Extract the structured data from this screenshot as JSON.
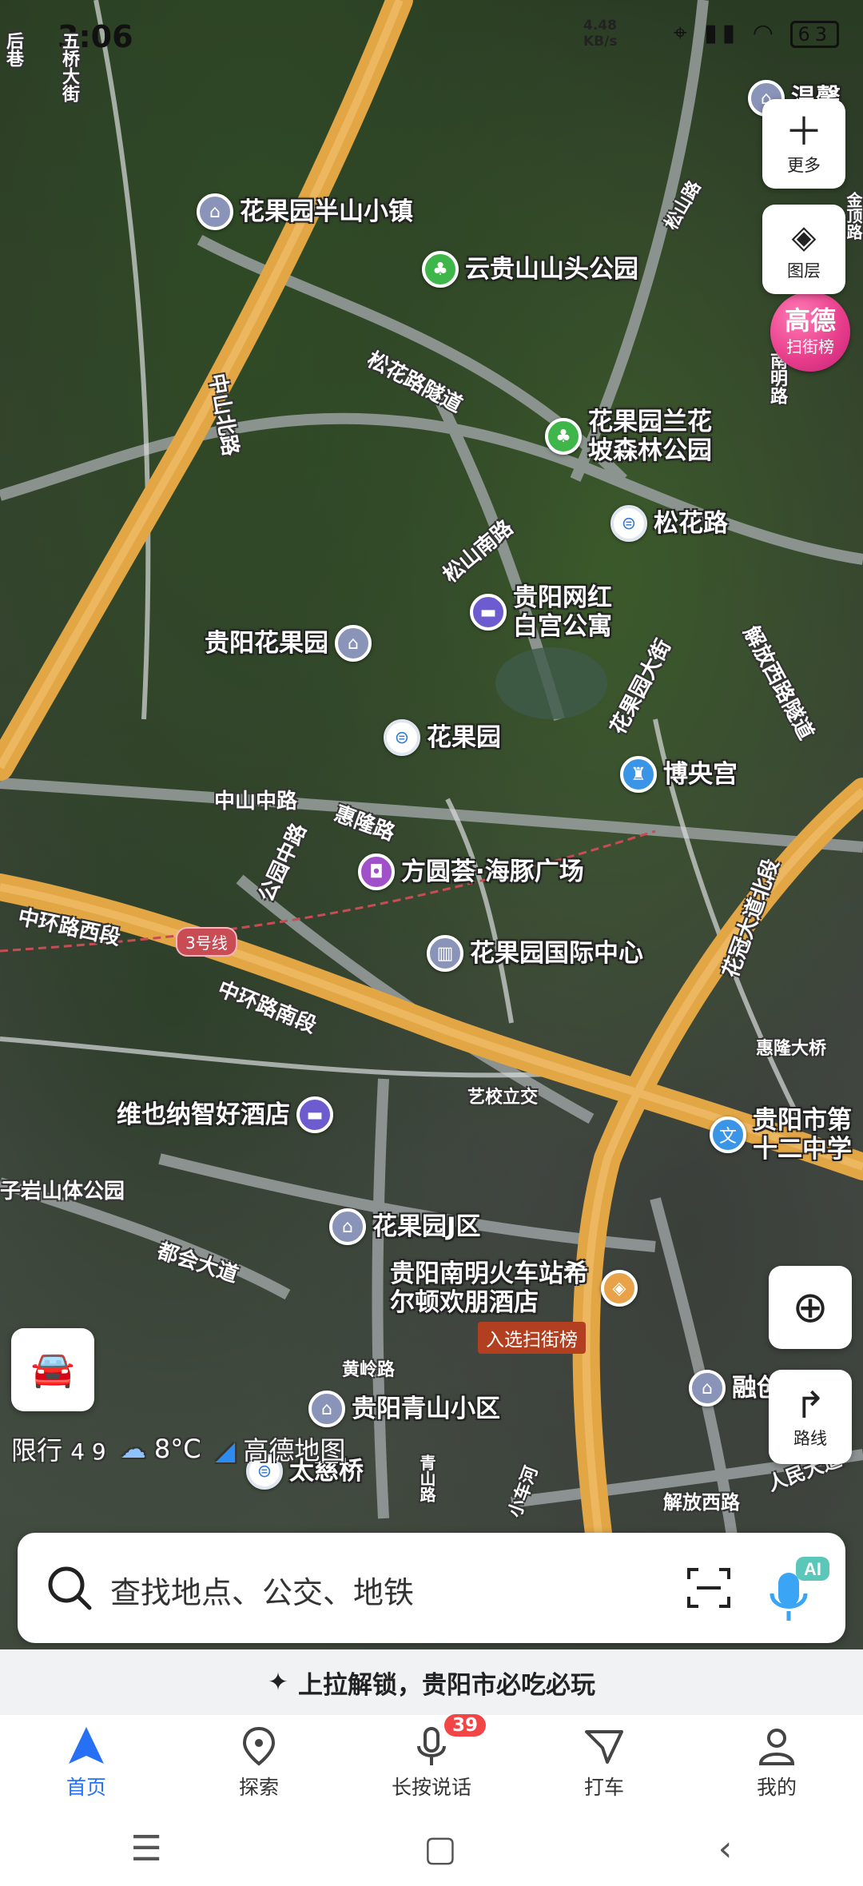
{
  "status_bar": {
    "time": "3:06",
    "net_speed": "4.48",
    "net_unit": "KB/s",
    "battery": "63"
  },
  "map": {
    "pois": [
      {
        "name": "花果园半山小镇",
        "type": "residential",
        "color": "#8a93b8"
      },
      {
        "name": "云贵山山头公园",
        "type": "park",
        "color": "#3fb64a"
      },
      {
        "name": "花果园兰花坡森林公园",
        "type": "park",
        "color": "#3fb64a"
      },
      {
        "name": "松花路",
        "type": "metro",
        "color": "#ffffff"
      },
      {
        "name": "贵阳网红白宫公寓",
        "type": "hotel",
        "color": "#6d5bd0"
      },
      {
        "name": "贵阳花果园",
        "type": "residential",
        "color": "#8a93b8"
      },
      {
        "name": "花果园",
        "type": "metro",
        "color": "#ffffff"
      },
      {
        "name": "博央宫",
        "type": "entertainment",
        "color": "#3a95e6"
      },
      {
        "name": "方圆荟·海豚广场",
        "type": "shopping",
        "color": "#a051c9"
      },
      {
        "name": "花果园国际中心",
        "type": "building",
        "color": "#8a93b8"
      },
      {
        "name": "维也纳智好酒店",
        "type": "hotel",
        "color": "#6d5bd0"
      },
      {
        "name": "贵阳市第十二中学",
        "type": "school",
        "color": "#3a95e6"
      },
      {
        "name": "花果园J区",
        "type": "residential",
        "color": "#8a93b8"
      },
      {
        "name": "贵阳南明火车站希尔顿欢朋酒店",
        "type": "hotel",
        "color": "#e8a24a"
      },
      {
        "name": "贵阳青山小区",
        "type": "residential",
        "color": "#8a93b8"
      },
      {
        "name": "融创",
        "type": "residential",
        "color": "#8a93b8"
      },
      {
        "name": "太慈桥",
        "type": "metro",
        "color": "#ffffff"
      },
      {
        "name": "温馨",
        "type": "residential",
        "color": "#8a93b8"
      }
    ],
    "road_labels": [
      "松花路隧道",
      "中环路西段",
      "松山南路",
      "花果园大街",
      "解放西路隧道",
      "中山中路",
      "惠隆路",
      "公园中路",
      "中环路南段",
      "艺校立交",
      "惠隆大桥",
      "都会大道",
      "黄岭路",
      "花冠大道北段",
      "五桥大街",
      "中山北路",
      "子岩山体公园",
      "后巷",
      "金顶路",
      "解放西路",
      "人民大道",
      "松山路",
      "南明路",
      "青山路",
      "小车河"
    ],
    "metro_line": "3号线",
    "rank_entry_tag": "入选扫街榜",
    "rank_badge": {
      "line1": "高德",
      "line2": "扫街榜"
    }
  },
  "side_buttons": {
    "more": "更多",
    "layers": "图层",
    "route": "路线"
  },
  "info_row": {
    "restriction_label": "限行",
    "restriction_value": "4 9",
    "temperature": "8°C",
    "brand": "高德地图"
  },
  "search": {
    "placeholder": "查找地点、公交、地铁",
    "ai_badge": "AI"
  },
  "promo": {
    "text": "上拉解锁，贵阳市必吃必玩"
  },
  "tabs": [
    {
      "label": "首页",
      "active": true
    },
    {
      "label": "探索",
      "active": false
    },
    {
      "label": "长按说话",
      "active": false,
      "badge": "39"
    },
    {
      "label": "打车",
      "active": false
    },
    {
      "label": "我的",
      "active": false
    }
  ]
}
